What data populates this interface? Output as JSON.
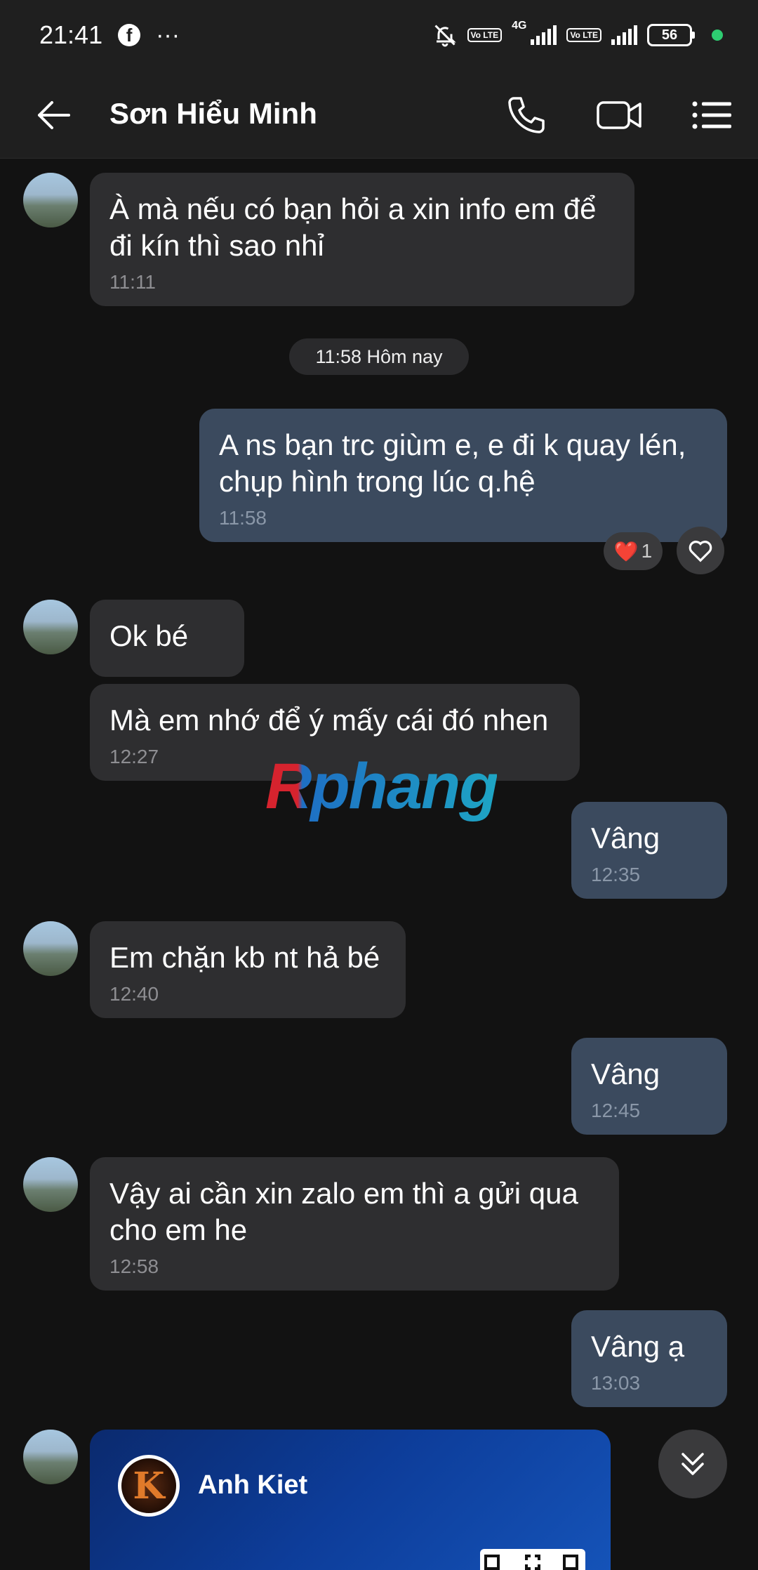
{
  "status_bar": {
    "time": "21:41",
    "more": "···",
    "network": "4G",
    "volte": "Vo LTE",
    "battery": "56"
  },
  "header": {
    "title": "Sơn Hiểu Minh"
  },
  "date_separator": "11:58 Hôm nay",
  "messages": [
    {
      "from": "them",
      "text": "À mà nếu có bạn hỏi a xin info em để đi kín thì sao nhỉ",
      "time": "11:11"
    },
    {
      "from": "me",
      "text": "A ns bạn trc giùm e, e đi k quay lén, chụp hình trong lúc q.hệ",
      "time": "11:58"
    },
    {
      "from": "them",
      "text": "Ok bé",
      "time": ""
    },
    {
      "from": "them",
      "text": "Mà em nhớ để ý mấy cái đó nhen",
      "time": "12:27"
    },
    {
      "from": "me",
      "text": "Vâng",
      "time": "12:35"
    },
    {
      "from": "them",
      "text": "Em chặn kb nt hả bé",
      "time": "12:40"
    },
    {
      "from": "me",
      "text": "Vâng",
      "time": "12:45"
    },
    {
      "from": "them",
      "text": "Vậy ai cần xin zalo em thì a gửi qua cho em he",
      "time": "12:58"
    },
    {
      "from": "me",
      "text": "Vâng ạ",
      "time": "13:03"
    }
  ],
  "reaction": {
    "emoji": "❤️",
    "count": "1"
  },
  "watermark": "Rphang",
  "contact_card": {
    "name": "Anh Kiet",
    "avatar_letter": "K"
  },
  "colors": {
    "background": "#121212",
    "bubble_in": "#2e2e30",
    "bubble_out": "#3b4a5e",
    "card": "#0d3d9a"
  }
}
